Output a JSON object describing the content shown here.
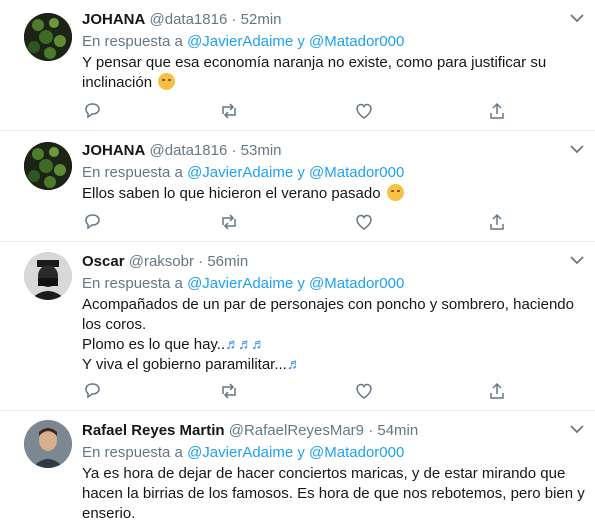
{
  "colors": {
    "accent": "#1da1f2",
    "muted": "#657786",
    "text": "#14171a",
    "divider": "#e6ecf0"
  },
  "icons": [
    "chevron-down-icon",
    "reply-icon",
    "retweet-icon",
    "like-icon",
    "share-icon",
    "emoji-icon",
    "music-notes-icon"
  ],
  "tweets": [
    {
      "name": "JOHANA",
      "handle": "@data1816",
      "dot": "·",
      "time": "52min",
      "reply_prefix": "En respuesta a",
      "mention1": "@JavierAdaime",
      "reply_and": "y",
      "mention2": "@Matador000",
      "lines": [
        "Y pensar que esa economía naranja no existe, como para justificar su",
        "inclinación"
      ]
    },
    {
      "name": "JOHANA",
      "handle": "@data1816",
      "dot": "·",
      "time": "53min",
      "reply_prefix": "En respuesta a",
      "mention1": "@JavierAdaime",
      "reply_and": "y",
      "mention2": "@Matador000",
      "lines": [
        "Ellos saben lo que hicieron el verano pasado"
      ]
    },
    {
      "name": "Oscar",
      "handle": "@raksobr",
      "dot": "·",
      "time": "56min",
      "reply_prefix": "En respuesta a",
      "mention1": "@JavierAdaime",
      "reply_and": "y",
      "mention2": "@Matador000",
      "lines": [
        "Acompañados de un par de personajes con poncho y sombrero, haciendo",
        "los coros.",
        "Plomo es lo que hay..",
        "Y viva el gobierno paramilitar..."
      ]
    },
    {
      "name": "Rafael Reyes Martin",
      "handle": "@RafaelReyesMar9",
      "dot": "·",
      "time": "54min",
      "reply_prefix": "En respuesta a",
      "mention1": "@JavierAdaime",
      "reply_and": "y",
      "mention2": "@Matador000",
      "lines": [
        "Ya es hora de dejar de hacer conciertos maricas, y de estar mirando que",
        "hacen la birrias de los famosos. Es hora de que nos rebotemos, pero bien y",
        "enserio."
      ]
    }
  ]
}
